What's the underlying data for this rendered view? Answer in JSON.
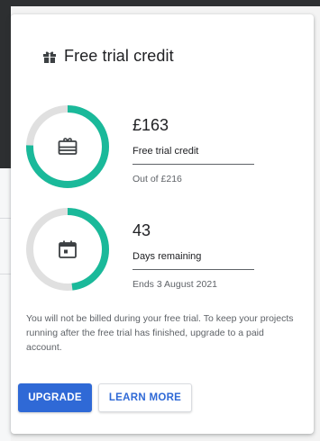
{
  "colors": {
    "accent": "#1ab99a",
    "track": "#e0e0e0",
    "primary_button": "#2f69d6",
    "text": "#202124",
    "muted": "#5f6368"
  },
  "card": {
    "title": "Free trial credit",
    "title_icon": "gift-icon"
  },
  "credit": {
    "value": "£163",
    "label": "Free trial credit",
    "sub": "Out of £216",
    "icon": "gift-card-icon",
    "fraction": 0.7546
  },
  "days": {
    "value": "43",
    "label": "Days remaining",
    "sub": "Ends 3 August 2021",
    "icon": "calendar-icon",
    "fraction": 0.48
  },
  "notice": "You will not be billed during your free trial. To keep your projects running after the free trial has finished, upgrade to a paid account.",
  "buttons": {
    "upgrade": "UPGRADE",
    "learn_more": "LEARN MORE"
  }
}
